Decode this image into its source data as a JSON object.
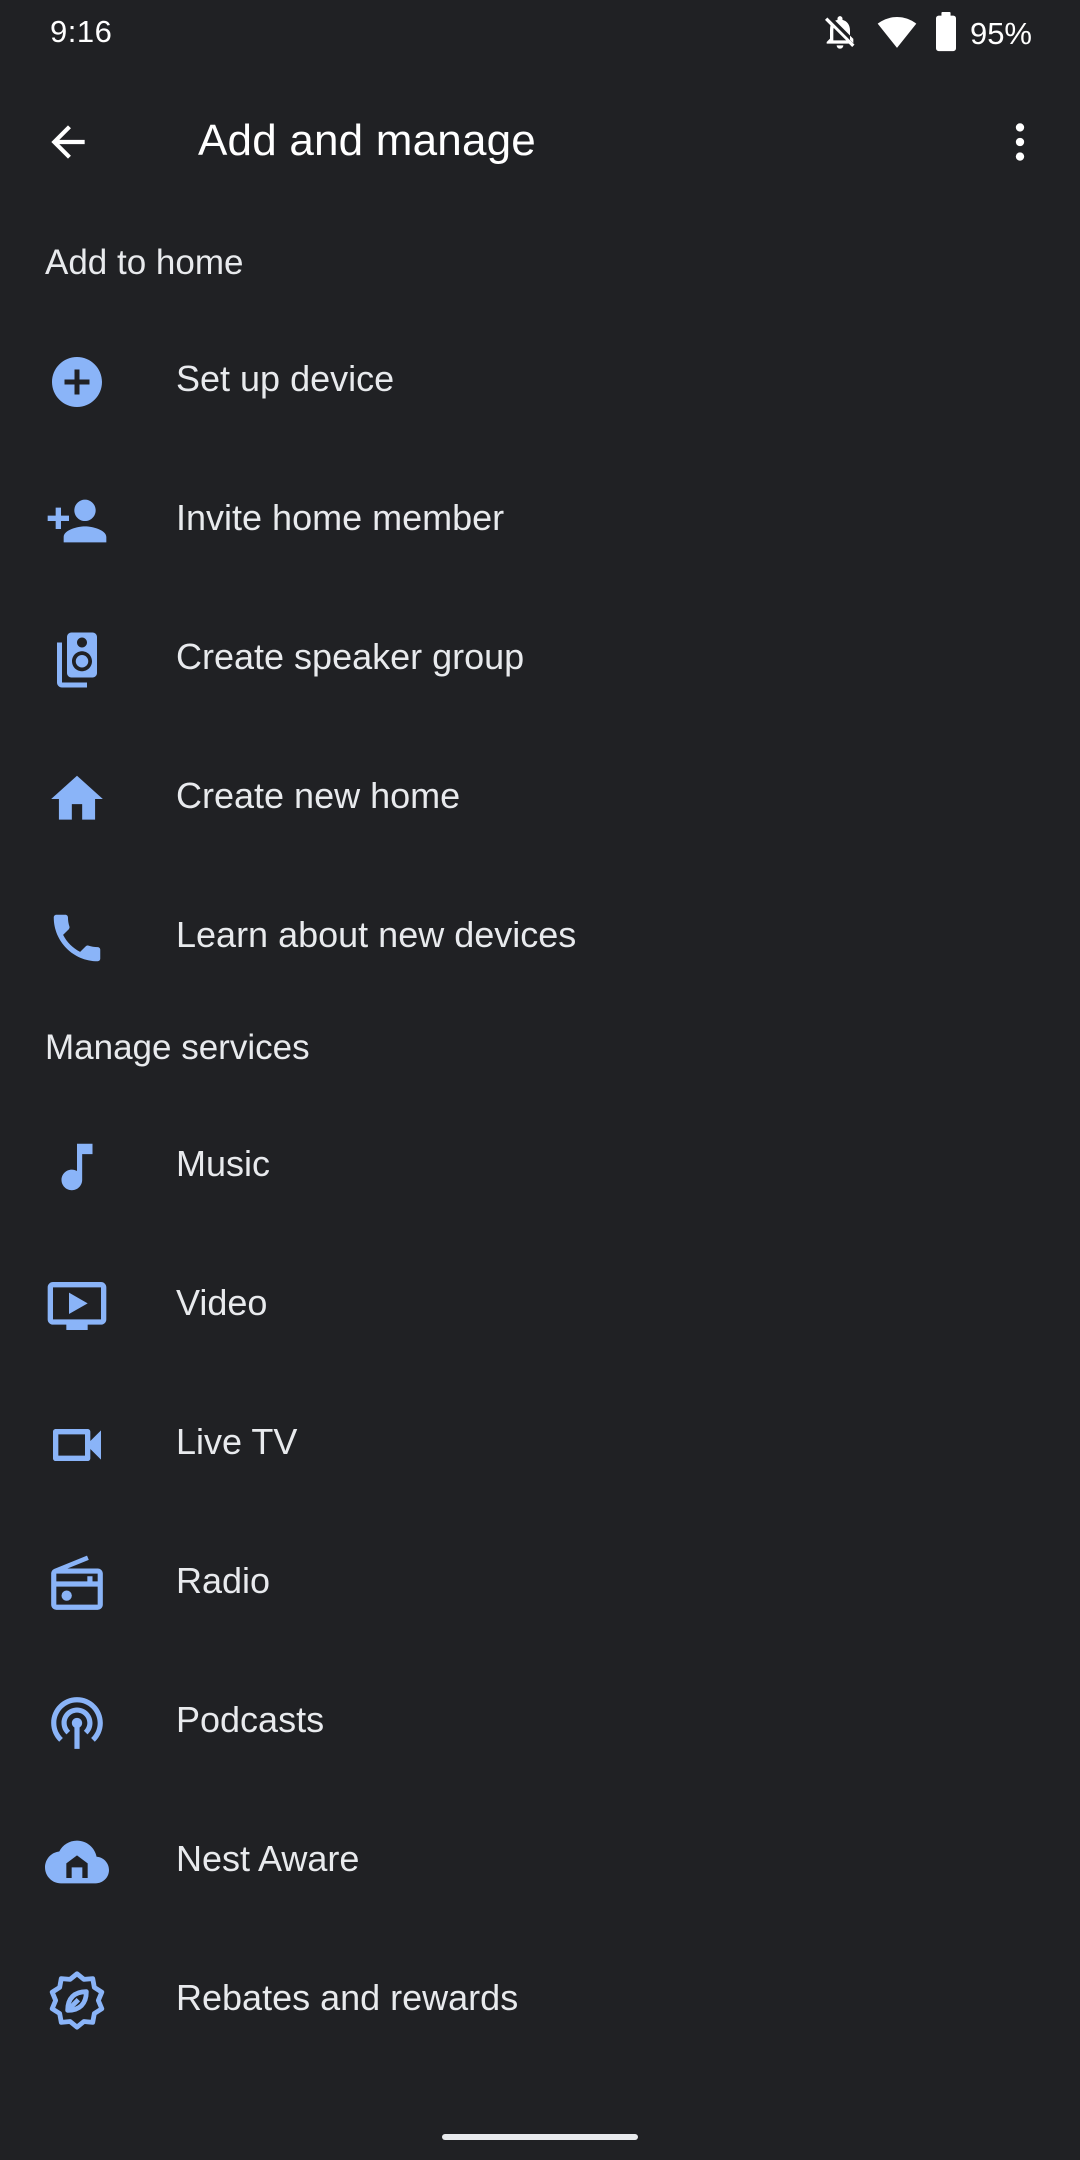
{
  "status_bar": {
    "time": "9:16",
    "battery": "95%",
    "icons": [
      "notifications-off-icon",
      "wifi-icon",
      "battery-icon"
    ]
  },
  "app_bar": {
    "title": "Add and manage",
    "back_icon": "arrow-back-icon",
    "overflow_icon": "more-vert-icon"
  },
  "colors": {
    "background": "#202124",
    "accent": "#8ab4f8",
    "text": "#e8eaed"
  },
  "sections": [
    {
      "header": "Add to home",
      "items": [
        {
          "label": "Set up device",
          "icon": "add-circle-icon"
        },
        {
          "label": "Invite home member",
          "icon": "person-add-icon"
        },
        {
          "label": "Create speaker group",
          "icon": "speaker-group-icon"
        },
        {
          "label": "Create new home",
          "icon": "home-icon"
        },
        {
          "label": "Learn about new devices",
          "icon": "phone-icon"
        }
      ]
    },
    {
      "header": "Manage services",
      "items": [
        {
          "label": "Music",
          "icon": "music-note-icon"
        },
        {
          "label": "Video",
          "icon": "video-icon"
        },
        {
          "label": "Live TV",
          "icon": "videocam-icon"
        },
        {
          "label": "Radio",
          "icon": "radio-icon"
        },
        {
          "label": "Podcasts",
          "icon": "podcasts-icon"
        },
        {
          "label": "Nest Aware",
          "icon": "nest-aware-icon"
        },
        {
          "label": "Rebates and rewards",
          "icon": "rebates-icon"
        }
      ]
    }
  ]
}
